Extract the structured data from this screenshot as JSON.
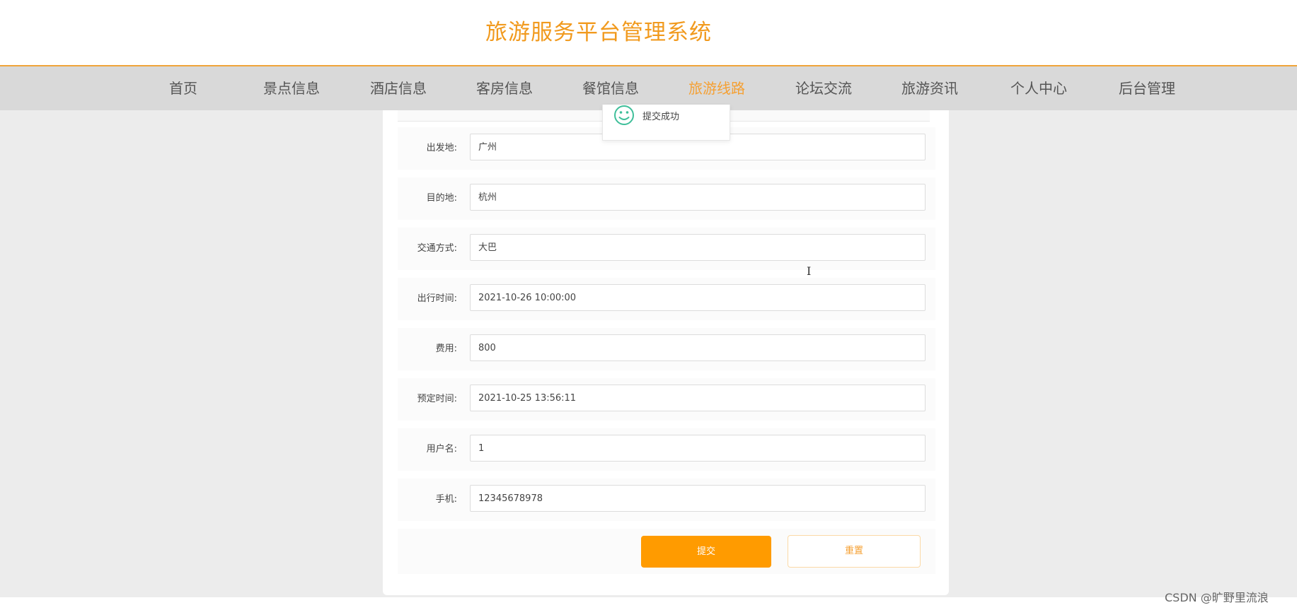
{
  "header": {
    "title": "旅游服务平台管理系统"
  },
  "nav": {
    "items": [
      {
        "label": "首页"
      },
      {
        "label": "景点信息"
      },
      {
        "label": "酒店信息"
      },
      {
        "label": "客房信息"
      },
      {
        "label": "餐馆信息"
      },
      {
        "label": "旅游线路",
        "active": true
      },
      {
        "label": "论坛交流"
      },
      {
        "label": "旅游资讯"
      },
      {
        "label": "个人中心"
      },
      {
        "label": "后台管理"
      }
    ],
    "active_color": "#f5a033"
  },
  "toast": {
    "message": "提交成功",
    "icon": "smile-icon"
  },
  "form": {
    "fields": [
      {
        "label": "出发地:",
        "value": "广州"
      },
      {
        "label": "目的地:",
        "value": "杭州"
      },
      {
        "label": "交通方式:",
        "value": "大巴"
      },
      {
        "label": "出行时间:",
        "value": "2021-10-26 10:00:00"
      },
      {
        "label": "费用:",
        "value": "800"
      },
      {
        "label": "预定时间:",
        "value": "2021-10-25 13:56:11"
      },
      {
        "label": "用户名:",
        "value": "1"
      },
      {
        "label": "手机:",
        "value": "12345678978"
      }
    ],
    "submit_label": "提交",
    "reset_label": "重置"
  },
  "watermark": "CSDN @旷野里流浪",
  "colors": {
    "accent": "#ff9b00",
    "title": "#f19a1e"
  }
}
